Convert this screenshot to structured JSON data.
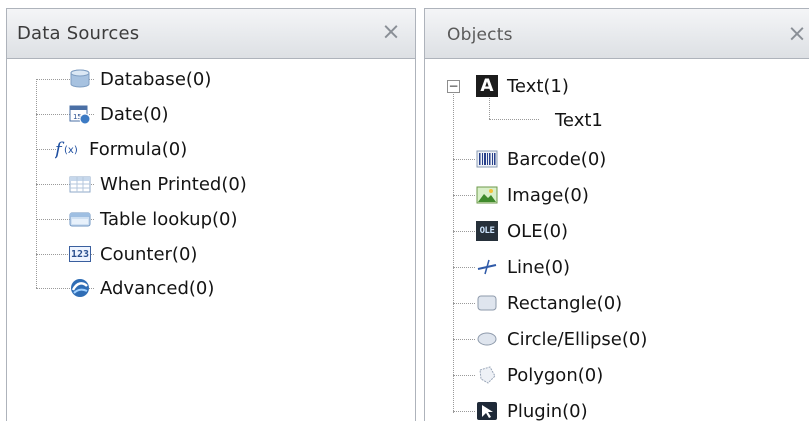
{
  "data_sources": {
    "title": "Data Sources",
    "close_glyph": "×",
    "items": [
      {
        "label": "Database(0)",
        "icon": "database-icon"
      },
      {
        "label": "Date(0)",
        "icon": "calendar-icon"
      },
      {
        "label": "Formula(0)",
        "icon": "formula-icon"
      },
      {
        "label": "When Printed(0)",
        "icon": "table-grid-icon"
      },
      {
        "label": "Table lookup(0)",
        "icon": "table-lookup-icon"
      },
      {
        "label": "Counter(0)",
        "icon": "counter-123-icon"
      },
      {
        "label": "Advanced(0)",
        "icon": "advanced-icon"
      }
    ]
  },
  "objects": {
    "title": "Objects",
    "close_glyph": "×",
    "items": [
      {
        "label": "Text(1)",
        "icon": "text-a-icon",
        "expanded": true,
        "expander_glyph": "−",
        "children": [
          {
            "label": "Text1"
          }
        ]
      },
      {
        "label": "Barcode(0)",
        "icon": "barcode-icon"
      },
      {
        "label": "Image(0)",
        "icon": "image-icon"
      },
      {
        "label": "OLE(0)",
        "icon": "ole-icon",
        "icon_text": "OLE"
      },
      {
        "label": "Line(0)",
        "icon": "line-icon"
      },
      {
        "label": "Rectangle(0)",
        "icon": "rectangle-icon"
      },
      {
        "label": "Circle/Ellipse(0)",
        "icon": "ellipse-icon"
      },
      {
        "label": "Polygon(0)",
        "icon": "polygon-icon"
      },
      {
        "label": "Plugin(0)",
        "icon": "plugin-icon"
      }
    ]
  },
  "colors": {
    "panel_border": "#aeb3bb",
    "header_gradient_top": "#f4f5f7",
    "header_gradient_bottom": "#dde0e4",
    "tree_line": "#9a9a9a"
  }
}
